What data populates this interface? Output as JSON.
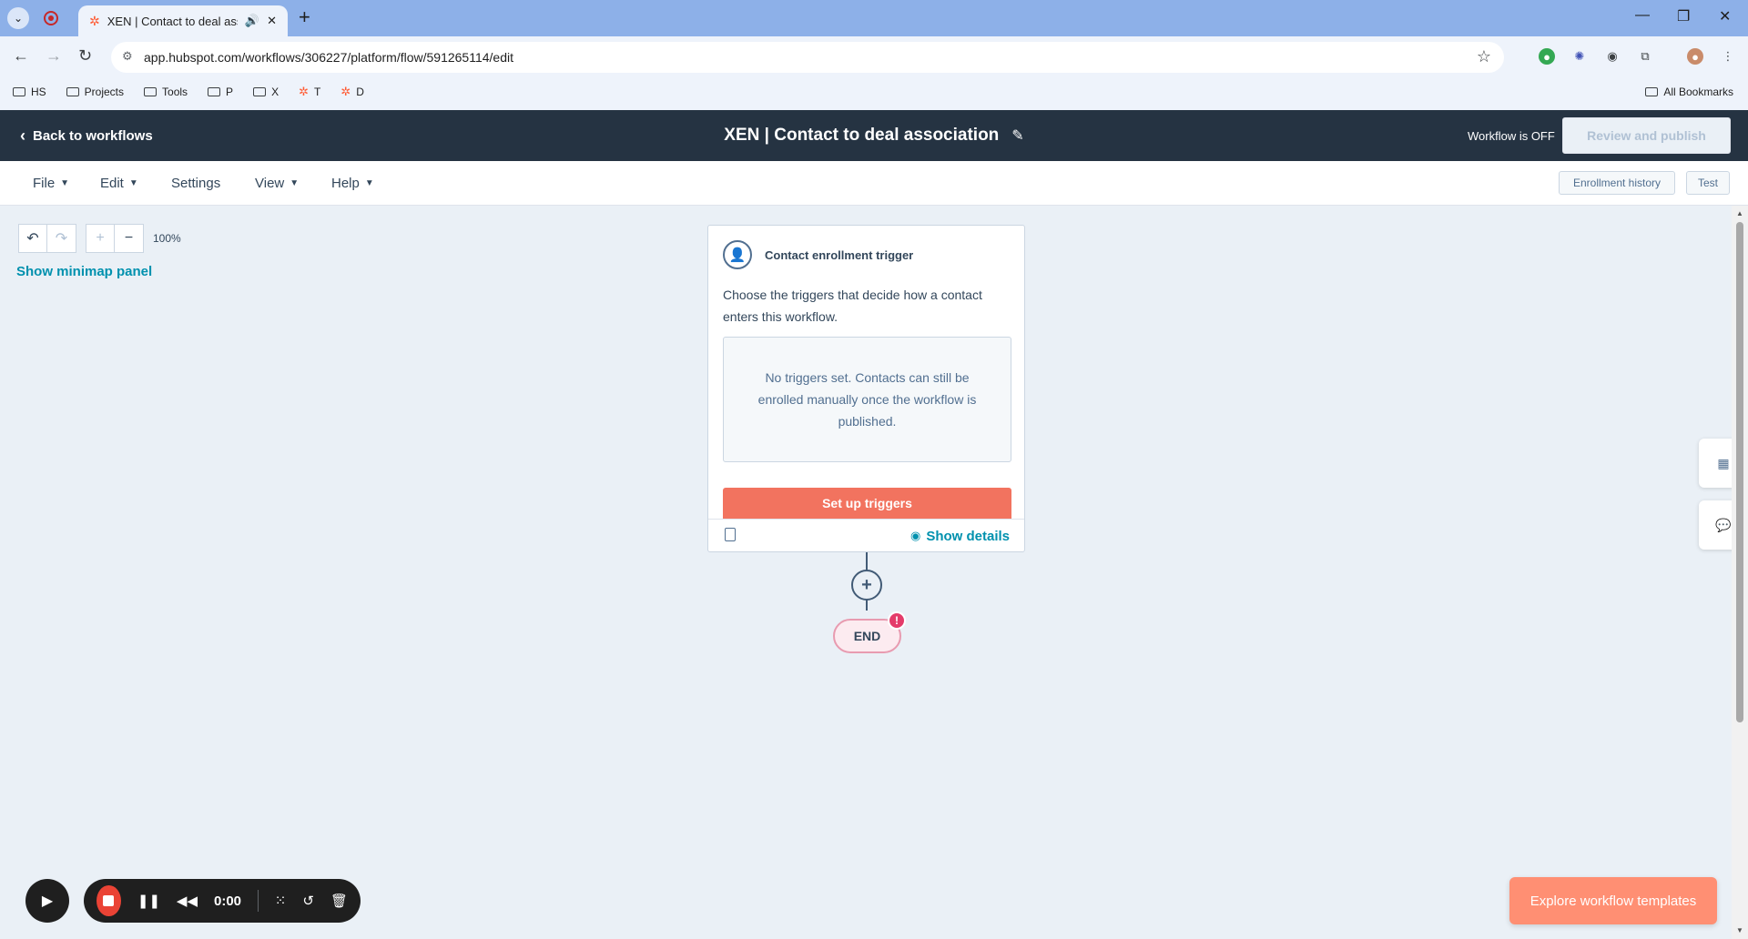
{
  "browser": {
    "tab_title": "XEN | Contact to deal asso",
    "url": "app.hubspot.com/workflows/306227/platform/flow/591265114/edit",
    "bookmarks": [
      "HS",
      "Projects",
      "Tools",
      "P",
      "X",
      "T",
      "D"
    ],
    "all_bookmarks": "All Bookmarks"
  },
  "header": {
    "back_label": "Back to workflows",
    "title": "XEN | Contact to deal association",
    "status": "Workflow is OFF",
    "review_label": "Review and publish"
  },
  "menu": {
    "items": [
      "File",
      "Edit",
      "Settings",
      "View",
      "Help"
    ],
    "enrollment_history": "Enrollment history",
    "test": "Test"
  },
  "canvas": {
    "zoom": "100%",
    "minimap_label": "Show minimap panel"
  },
  "trigger_card": {
    "title": "Contact enrollment trigger",
    "description": "Choose the triggers that decide how a contact enters this workflow.",
    "empty_text": "No triggers set. Contacts can still be enrolled manually once the workflow is published.",
    "setup_label": "Set up triggers",
    "details_label": "Show details"
  },
  "end_node": {
    "label": "END",
    "alert": "!"
  },
  "recorder": {
    "time": "0:00"
  },
  "explore_label": "Explore workflow templates",
  "colors": {
    "header_bg": "#253342",
    "accent_teal": "#0091ae",
    "cta_coral": "#f2735f",
    "explore_orange": "#ff8f73"
  }
}
